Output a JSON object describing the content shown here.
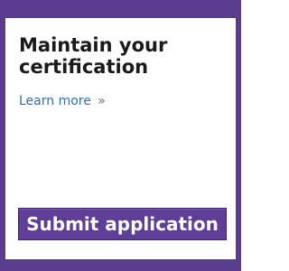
{
  "panel": {
    "title": "Maintain your certification",
    "link_label": "Learn more",
    "link_chevron": "»",
    "button_label": "Submit application"
  },
  "colors": {
    "frame": "#5b3d8f",
    "button_bg": "#5e3e96",
    "link": "#2b6fb6",
    "heading": "#1a1a1a"
  }
}
